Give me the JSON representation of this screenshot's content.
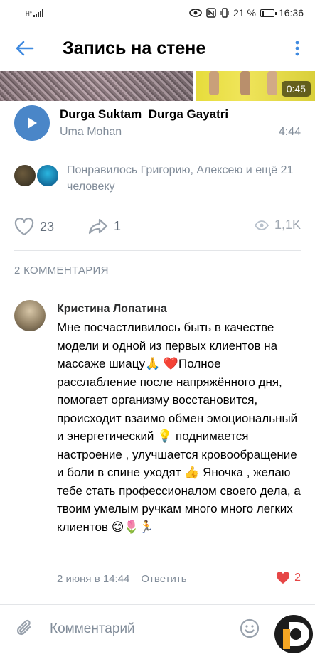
{
  "status_bar": {
    "carrier_small": "Н°",
    "battery_percent": "21 %",
    "time": "16:36",
    "battery_level": 0.21
  },
  "header": {
    "title": "Запись на стене",
    "back_icon": "arrow-left-icon",
    "menu_icon": "more-vertical-icon",
    "accent_color": "#3f8ae0"
  },
  "media": {
    "duration": "0:45"
  },
  "audio": {
    "title": "Durga Suktam  Durga Gayatri",
    "artist": "Uma Mohan",
    "duration": "4:44"
  },
  "likes": {
    "text": "Понравилось Григорию, Алексею и ещё 21 человеку"
  },
  "actions": {
    "likes_count": "23",
    "shares_count": "1",
    "views_count": "1,1K"
  },
  "comments": {
    "count_label": "2 КОММЕНТАРИЯ",
    "items": [
      {
        "author": "Кристина Лопатина",
        "text": "Мне посчастливилось быть в качестве модели и одной из первых клиентов на массаже шиацу🙏 ❤️Полное расслабление после напряжённого дня, помогает организму восстановится, происходит взаимо обмен эмоциональный и энергетический 💡 поднимается настроение , улучшается кровообращение и боли в спине уходят 👍 Яночка , желаю тебе стать профессионалом своего дела, а твоим умелым ручкам много много легких клиентов 😊🌷🏃",
        "date": "2 июня в 14:44",
        "reply_label": "Ответить",
        "likes": "2",
        "like_color": "#e64646"
      }
    ]
  },
  "composer": {
    "placeholder": "Комментарий"
  }
}
